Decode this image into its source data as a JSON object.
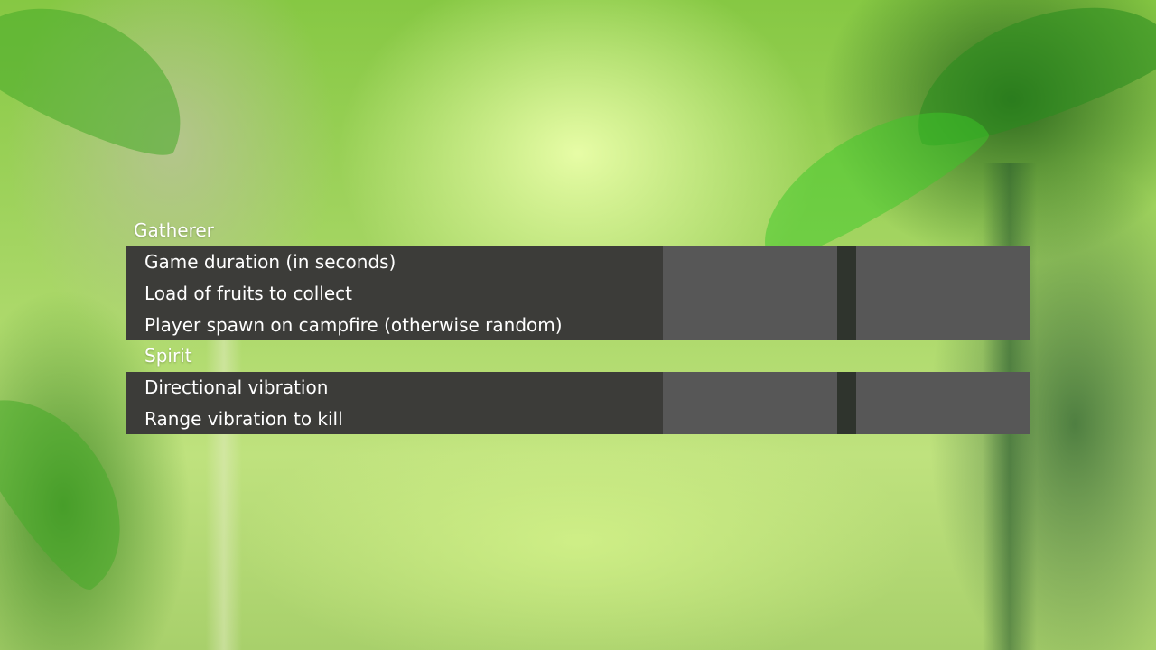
{
  "sections": [
    {
      "title": "Gatherer",
      "rows": [
        {
          "label": "Game duration (in seconds)"
        },
        {
          "label": "Load of fruits to collect"
        },
        {
          "label": "Player spawn on campfire (otherwise random)"
        }
      ]
    },
    {
      "title": "Spirit",
      "rows": [
        {
          "label": "Directional vibration"
        },
        {
          "label": "Range vibration to kill"
        }
      ]
    }
  ]
}
